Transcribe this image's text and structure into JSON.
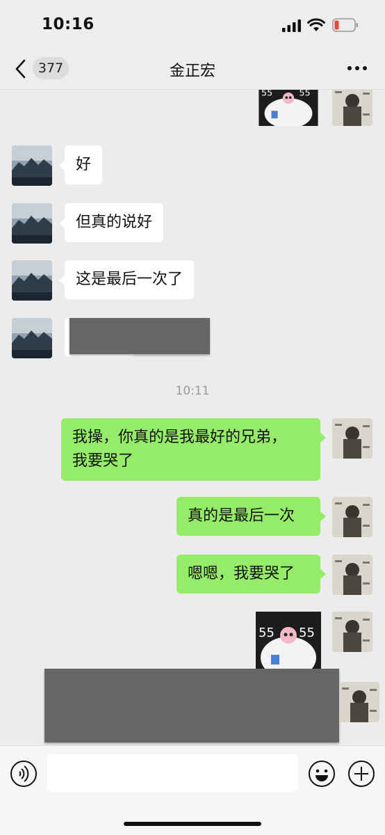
{
  "status_bar": {
    "time": "10:16",
    "battery_color": "#e8453c"
  },
  "nav": {
    "back_count": "377",
    "title": "金正宏"
  },
  "messages": [
    {
      "from": "contact",
      "text": "好"
    },
    {
      "from": "contact",
      "text": "但真的说好"
    },
    {
      "from": "contact",
      "text": "这是最后一次了"
    },
    {
      "from": "contact",
      "text": "",
      "redacted": true
    },
    {
      "timestamp": "10:11"
    },
    {
      "from": "me",
      "text": "我操，你真的是我最好的兄弟，\n我要哭了"
    },
    {
      "from": "me",
      "text": "真的是最后一次"
    },
    {
      "from": "me",
      "text": "嗯嗯，我要哭了"
    },
    {
      "from": "me",
      "sticker": "crying-skull-sticker"
    },
    {
      "from": "me",
      "text": "",
      "redacted": true
    }
  ],
  "colors": {
    "incoming_bubble": "#ffffff",
    "outgoing_bubble": "#95ec69",
    "background": "#ececec"
  },
  "icons": {
    "voice": "voice-icon",
    "emoji": "emoji-icon",
    "add": "plus-circle-icon",
    "more": "more-icon",
    "back": "chevron-left-icon"
  }
}
